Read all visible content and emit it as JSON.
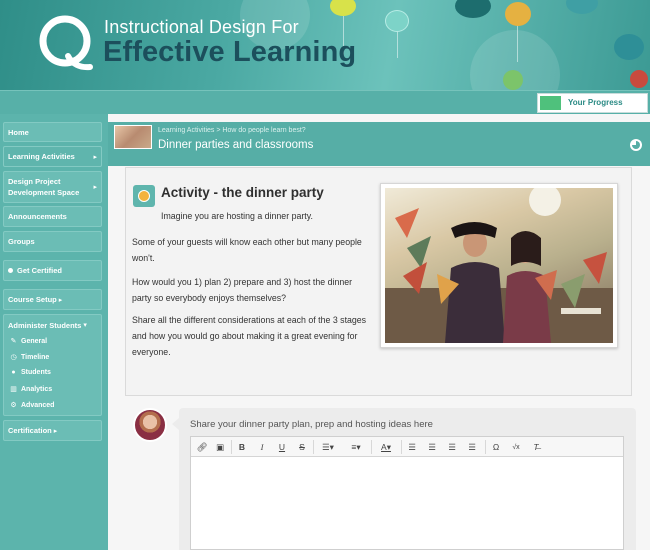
{
  "banner": {
    "title_line1": "Instructional Design For",
    "title_line2": "Effective Learning"
  },
  "progress": {
    "label": "Your Progress",
    "fraction": 0.2,
    "color": "#4fc17c"
  },
  "sidebar": {
    "items": [
      {
        "label": "Home"
      },
      {
        "label": "Learning Activities"
      },
      {
        "label": "Design Project\nDevelopment Space"
      },
      {
        "label": "Announcements"
      },
      {
        "label": "Groups"
      },
      {
        "label": "Get Certified"
      },
      {
        "label": "Course Setup"
      },
      {
        "label": "Administer Students"
      },
      {
        "label": "Certification"
      }
    ],
    "admin_sub": [
      {
        "label": "General",
        "icon": "pencil-icon"
      },
      {
        "label": "Timeline",
        "icon": "clock-icon"
      },
      {
        "label": "Students",
        "icon": "person-icon"
      },
      {
        "label": "Analytics",
        "icon": "bar-chart-icon"
      },
      {
        "label": "Advanced",
        "icon": "cogs-icon"
      }
    ]
  },
  "content": {
    "breadcrumb": "Learning Activities  >  How do people learn best?",
    "page_title": "Dinner parties and classrooms",
    "activity": {
      "title": "Activity - the dinner party",
      "intro": "Imagine you are hosting a dinner party.",
      "p1": "Some of your guests will know each other but many people won't.",
      "p2": "How would you 1) plan 2) prepare and 3) host the dinner party so everybody enjoys themselves?",
      "p3": "Share all the different considerations at each of the 3 stages and how you would go about making it a great evening for everyone."
    },
    "comment": {
      "prompt": "Share your dinner party plan, prep and hosting ideas here"
    }
  },
  "colors": {
    "teal": "#5fb5ad",
    "brand_dark": "#1c4f5c",
    "accent_green": "#4fc17c"
  }
}
